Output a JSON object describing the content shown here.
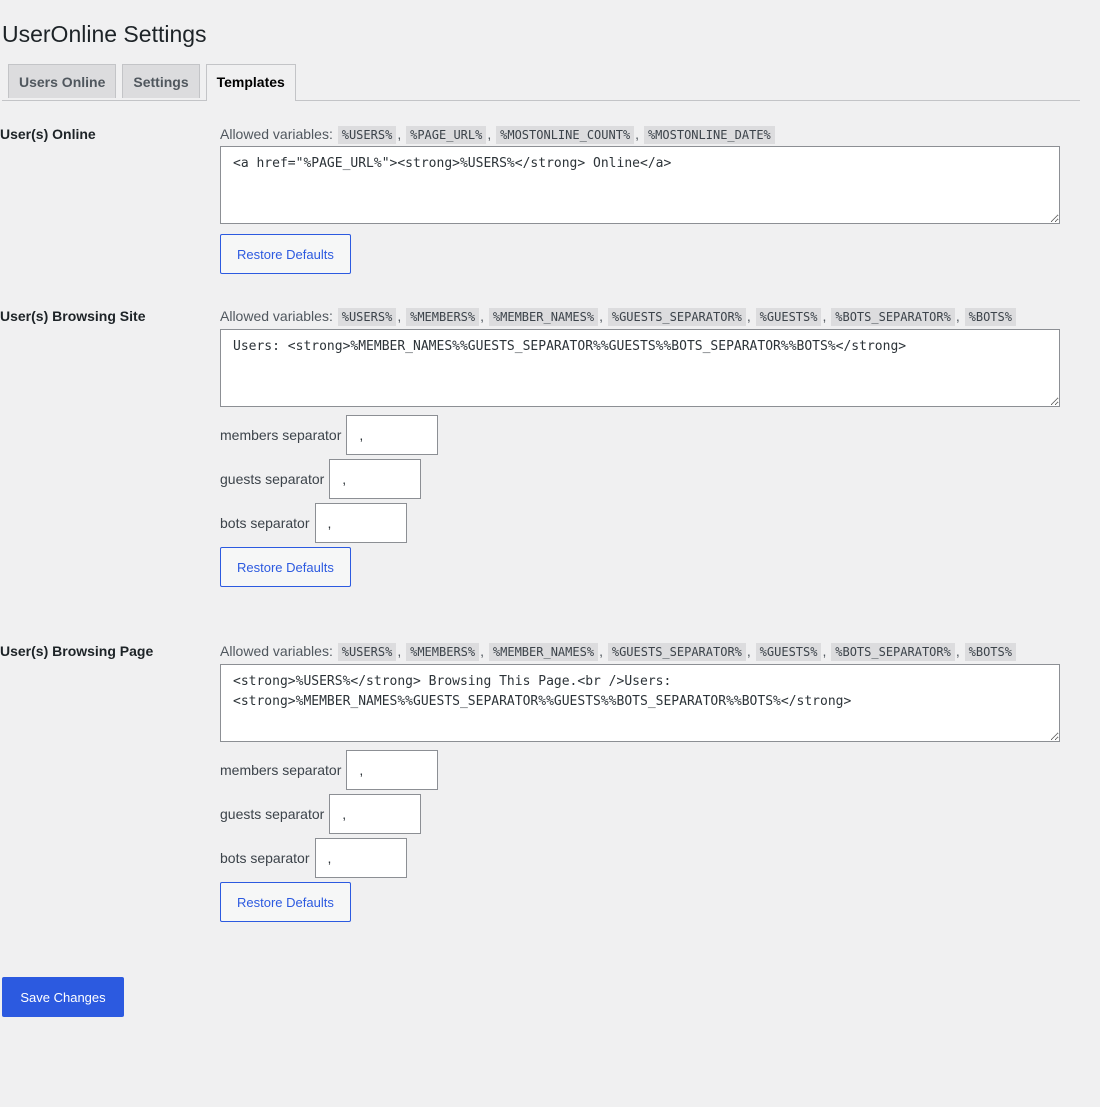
{
  "page_title": "UserOnline Settings",
  "tabs": [
    {
      "label": "Users Online"
    },
    {
      "label": "Settings"
    },
    {
      "label": "Templates"
    }
  ],
  "allowed_label": "Allowed variables:",
  "restore_label": "Restore Defaults",
  "save_label": "Save Changes",
  "sections": {
    "online": {
      "label": "User(s) Online",
      "vars": [
        "%USERS%",
        "%PAGE_URL%",
        "%MOSTONLINE_COUNT%",
        "%MOSTONLINE_DATE%"
      ],
      "template": "<a href=\"%PAGE_URL%\"><strong>%USERS%</strong> Online</a>"
    },
    "site": {
      "label": "User(s) Browsing Site",
      "vars": [
        "%USERS%",
        "%MEMBERS%",
        "%MEMBER_NAMES%",
        "%GUESTS_SEPARATOR%",
        "%GUESTS%",
        "%BOTS_SEPARATOR%",
        "%BOTS%"
      ],
      "template": "Users: <strong>%MEMBER_NAMES%%GUESTS_SEPARATOR%%GUESTS%%BOTS_SEPARATOR%%BOTS%</strong>",
      "members_separator_label": "members separator",
      "members_separator_value": ",",
      "guests_separator_label": "guests separator",
      "guests_separator_value": ",",
      "bots_separator_label": "bots separator",
      "bots_separator_value": ","
    },
    "page": {
      "label": "User(s) Browsing Page",
      "vars": [
        "%USERS%",
        "%MEMBERS%",
        "%MEMBER_NAMES%",
        "%GUESTS_SEPARATOR%",
        "%GUESTS%",
        "%BOTS_SEPARATOR%",
        "%BOTS%"
      ],
      "template": "<strong>%USERS%</strong> Browsing This Page.<br />Users: <strong>%MEMBER_NAMES%%GUESTS_SEPARATOR%%GUESTS%%BOTS_SEPARATOR%%BOTS%</strong>",
      "members_separator_label": "members separator",
      "members_separator_value": ",",
      "guests_separator_label": "guests separator",
      "guests_separator_value": ",",
      "bots_separator_label": "bots separator",
      "bots_separator_value": ","
    }
  }
}
